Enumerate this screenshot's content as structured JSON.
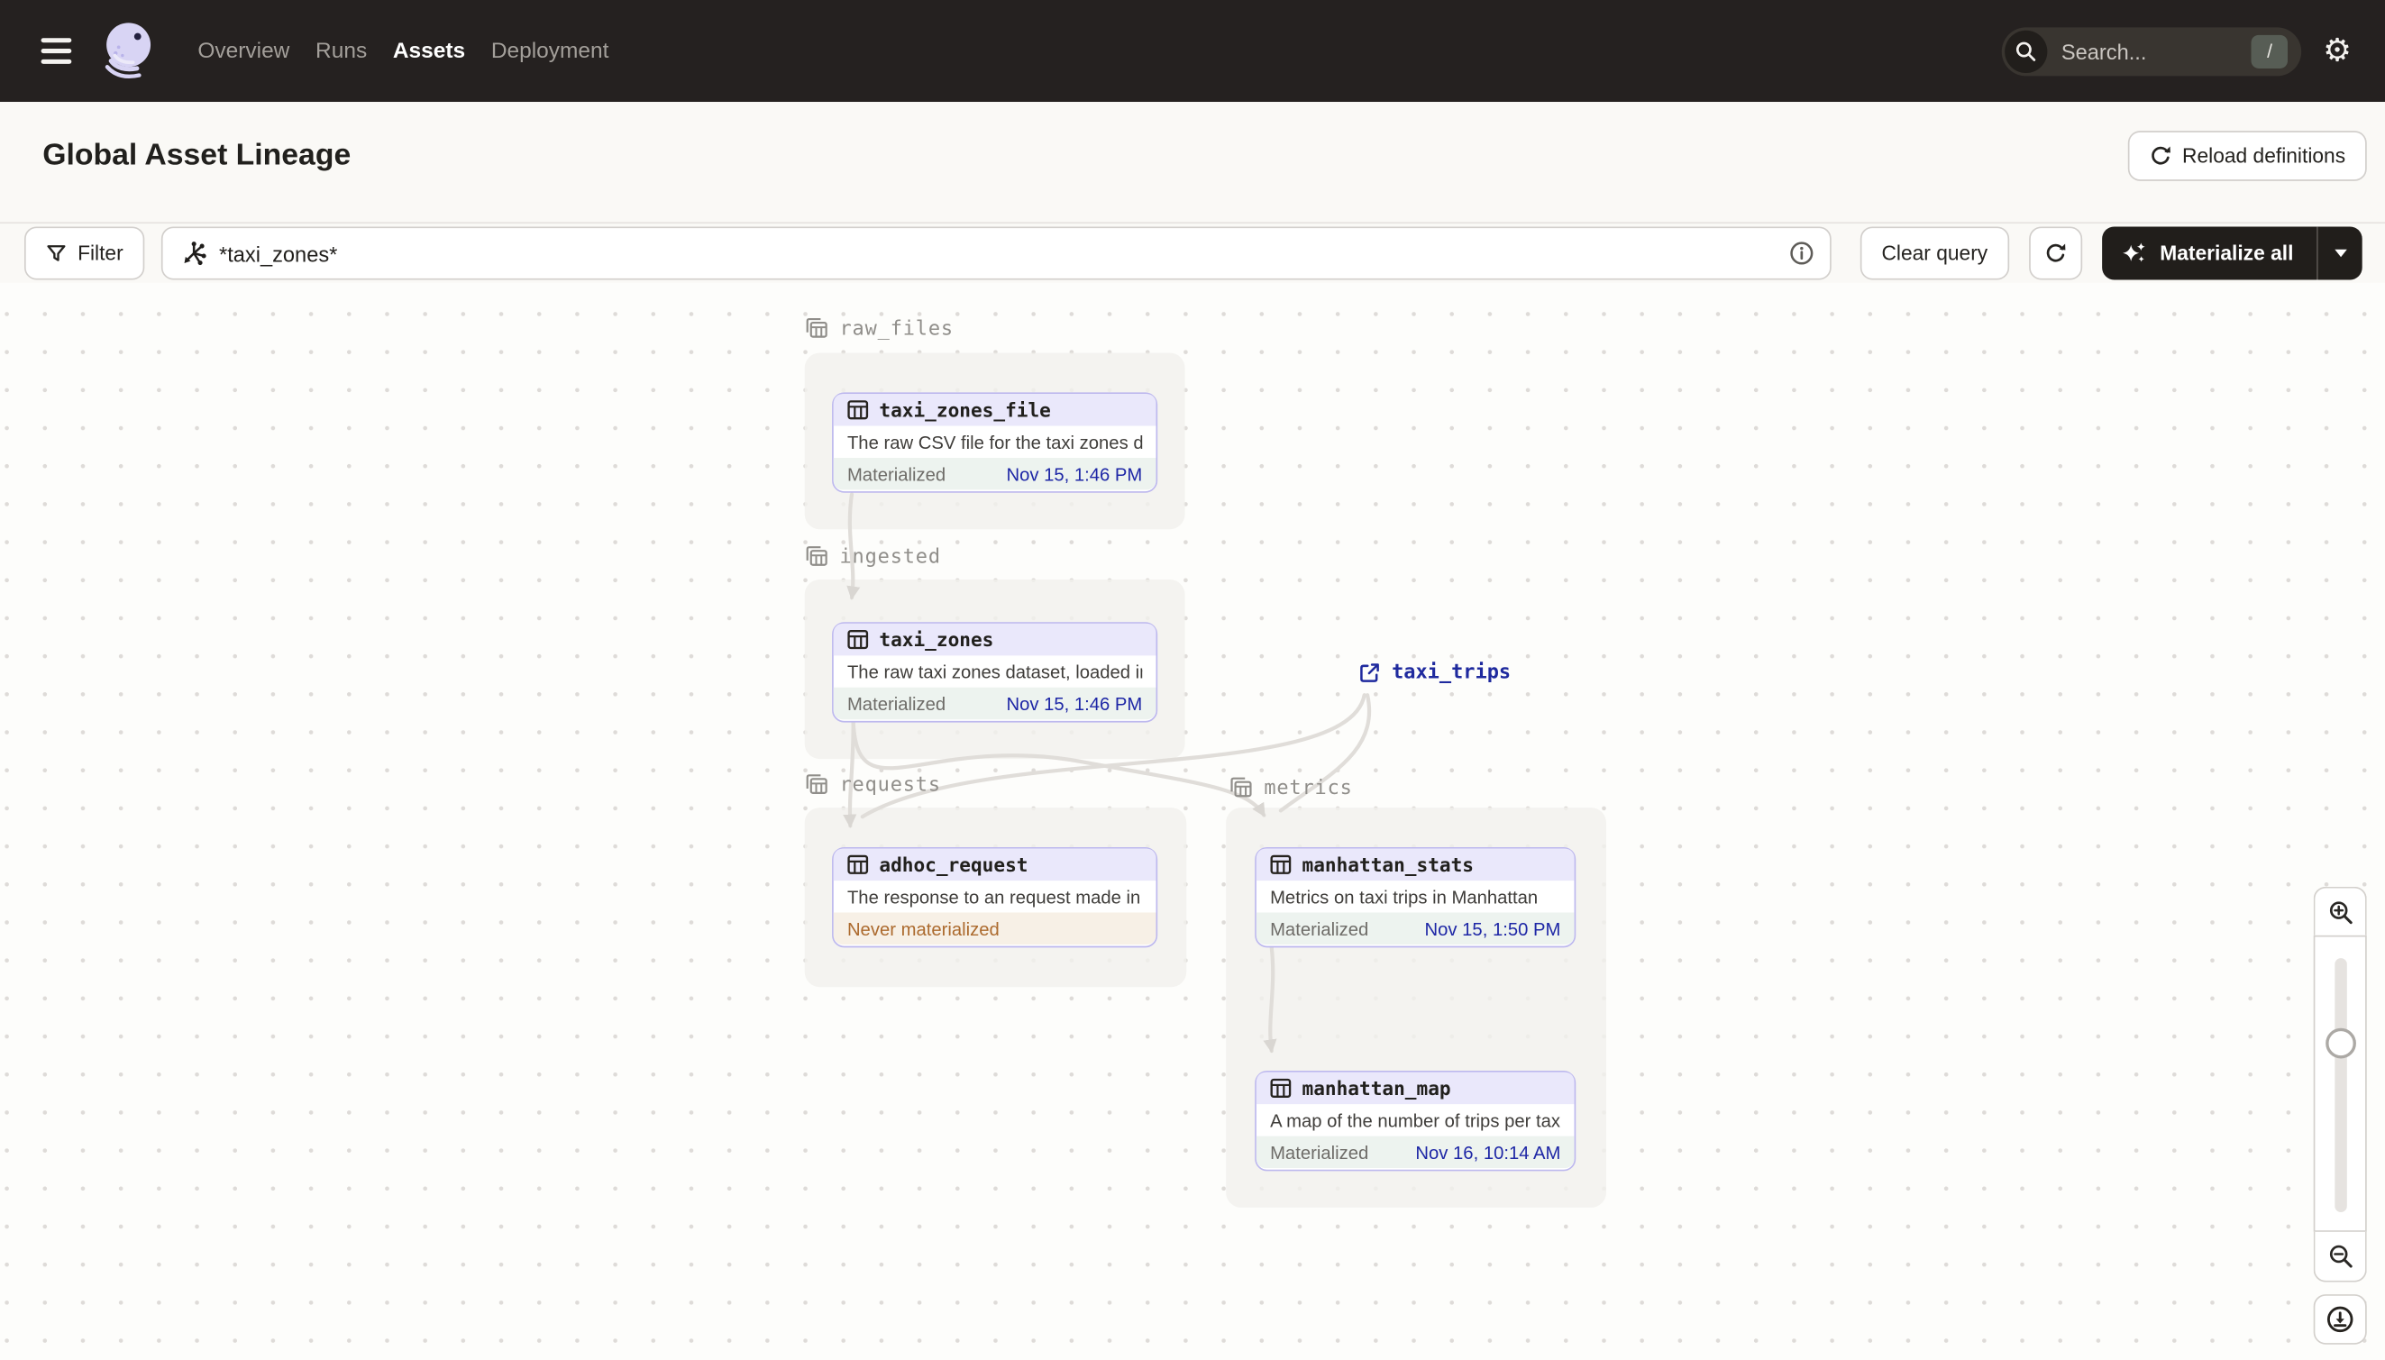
{
  "nav": {
    "items": [
      {
        "label": "Overview",
        "active": false
      },
      {
        "label": "Runs",
        "active": false
      },
      {
        "label": "Assets",
        "active": true
      },
      {
        "label": "Deployment",
        "active": false
      }
    ],
    "search_placeholder": "Search...",
    "search_shortcut": "/"
  },
  "header": {
    "title": "Global Asset Lineage",
    "reload_button": "Reload definitions"
  },
  "toolbar": {
    "filter_label": "Filter",
    "query_value": "*taxi_zones*",
    "clear_button": "Clear query",
    "materialize_button": "Materialize all"
  },
  "graph": {
    "groups": [
      {
        "name": "raw_files"
      },
      {
        "name": "ingested"
      },
      {
        "name": "requests"
      },
      {
        "name": "metrics"
      }
    ],
    "nodes": [
      {
        "title": "taxi_zones_file",
        "description": "The raw CSV file for the taxi zones dat...",
        "status": "Materialized",
        "timestamp": "Nov 15, 1:46 PM"
      },
      {
        "title": "taxi_zones",
        "description": "The raw taxi zones dataset, loaded int...",
        "status": "Materialized",
        "timestamp": "Nov 15, 1:46 PM"
      },
      {
        "title": "adhoc_request",
        "description": "The response to an request made in th...",
        "status": "Never materialized",
        "timestamp": ""
      },
      {
        "title": "manhattan_stats",
        "description": "Metrics on taxi trips in Manhattan",
        "status": "Materialized",
        "timestamp": "Nov 15, 1:50 PM"
      },
      {
        "title": "manhattan_map",
        "description": "A map of the number of trips per taxi z...",
        "status": "Materialized",
        "timestamp": "Nov 16, 10:14 AM"
      }
    ],
    "external_assets": [
      {
        "title": "taxi_trips"
      }
    ]
  },
  "colors": {
    "navbar_bg": "#252120",
    "node_border": "#BDB8EE",
    "node_header_bg": "#EAE8FB",
    "materialized_bg": "#EDF3EF",
    "timestamp_blue": "#1E27A6",
    "never_materialized_bg": "#F7F0E6",
    "never_materialized_text": "#AC6A2E",
    "group_label_text": "#908E8A",
    "edge_gray": "#E0DDD9",
    "dark_button_bg": "#211E1B"
  }
}
